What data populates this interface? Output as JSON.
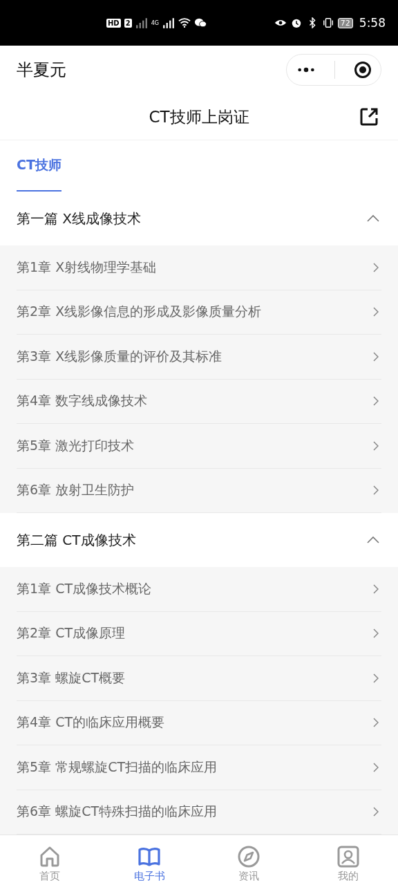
{
  "status_bar": {
    "hd": "HD",
    "sim": "2",
    "network": "4G",
    "battery": "72",
    "time": "5:58"
  },
  "app_bar": {
    "title": "半夏元"
  },
  "page_header": {
    "title": "CT技师上岗证"
  },
  "tabs": [
    {
      "label": "CT技师",
      "selected": true
    }
  ],
  "parts": [
    {
      "title": "第一篇 X线成像技术",
      "expanded": true,
      "chapters": [
        {
          "title": "第1章 X射线物理学基础"
        },
        {
          "title": "第2章 X线影像信息的形成及影像质量分析"
        },
        {
          "title": "第3章 X线影像质量的评价及其标准"
        },
        {
          "title": "第4章 数字线成像技术"
        },
        {
          "title": "第5章 激光打印技术"
        },
        {
          "title": "第6章 放射卫生防护"
        }
      ]
    },
    {
      "title": "第二篇 CT成像技术",
      "expanded": true,
      "chapters": [
        {
          "title": "第1章 CT成像技术概论"
        },
        {
          "title": "第2章 CT成像原理"
        },
        {
          "title": "第3章 螺旋CT概要"
        },
        {
          "title": "第4章 CT的临床应用概要"
        },
        {
          "title": "第5章 常规螺旋CT扫描的临床应用"
        },
        {
          "title": "第6章 螺旋CT特殊扫描的临床应用"
        }
      ]
    }
  ],
  "bottom_nav": [
    {
      "label": "首页",
      "kind": "home",
      "selected": false
    },
    {
      "label": "电子书",
      "kind": "book",
      "selected": true
    },
    {
      "label": "资讯",
      "kind": "compass",
      "selected": false
    },
    {
      "label": "我的",
      "kind": "profile",
      "selected": false
    }
  ]
}
